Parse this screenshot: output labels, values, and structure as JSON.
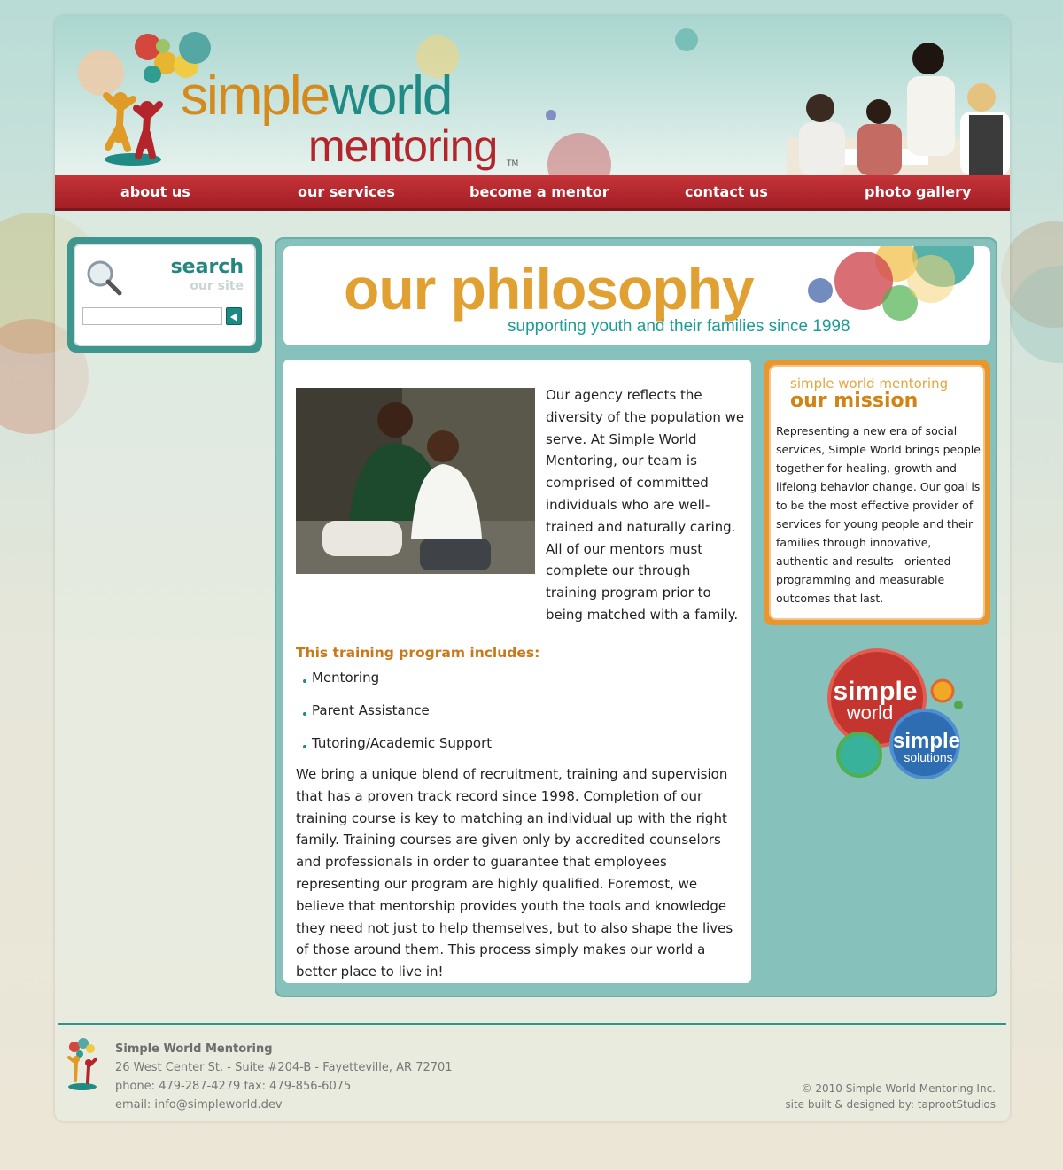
{
  "brand": {
    "logo_word_simple": "simple",
    "logo_word_world": "world",
    "logo_word_mentoring": "mentoring",
    "tm": "TM"
  },
  "nav": {
    "items": [
      "about us",
      "our services",
      "become a mentor",
      "contact us",
      "photo gallery"
    ]
  },
  "search": {
    "title": "search",
    "subtitle": "our site",
    "placeholder": "",
    "button_icon": "arrow-left-icon"
  },
  "banner": {
    "title": "our philosophy",
    "subtitle": "supporting youth and their families since 1998"
  },
  "content": {
    "intro": "Our agency reflects the diversity of the population we serve. At Simple World Mentoring, our team is comprised of committed individuals who are well-trained and naturally caring. All of our mentors must complete our through training program prior to being matched with a family.",
    "training_heading": "This training program includes:",
    "training_items": [
      "Mentoring",
      "Parent Assistance",
      "Tutoring/Academic Support"
    ],
    "body": "We bring a unique blend of recruitment, training and supervision that has a proven track record since 1998. Completion of our training course is key to matching an individual up with the right family. Training courses are given only by accredited counselors and professionals in order to guarantee that employees representing our program are highly qualified. Foremost, we believe that mentorship provides youth the tools and knowledge they need not just to help themselves, but to also shape the lives of those around them. This process simply makes our world a better place to live in!"
  },
  "mission": {
    "kicker": "simple world mentoring",
    "title": "our mission",
    "text": "Representing a new era of social services, Simple World brings people together for healing, growth and lifelong behavior change. Our goal is to be the most effective provider of services for young people and their families through innovative, authentic and results - oriented programming and measurable outcomes that last."
  },
  "badge": {
    "top_word": "simple",
    "top_word2": "world",
    "bottom_word": "simple",
    "bottom_word2": "solutions"
  },
  "footer": {
    "org": "Simple World Mentoring",
    "address": "26 West Center St. - Suite #204-B - Fayetteville, AR 72701",
    "phone": "phone: 479-287-4279 fax: 479-856-6075",
    "email": "email: info@simpleworld.dev",
    "copyright": "© 2010 Simple World Mentoring Inc.",
    "credit": "site built & designed by: taprootStudios"
  },
  "colors": {
    "nav_red": "#b3252b",
    "teal": "#1f8b84",
    "orange": "#e1a032",
    "mission_orange": "#e9962e"
  }
}
